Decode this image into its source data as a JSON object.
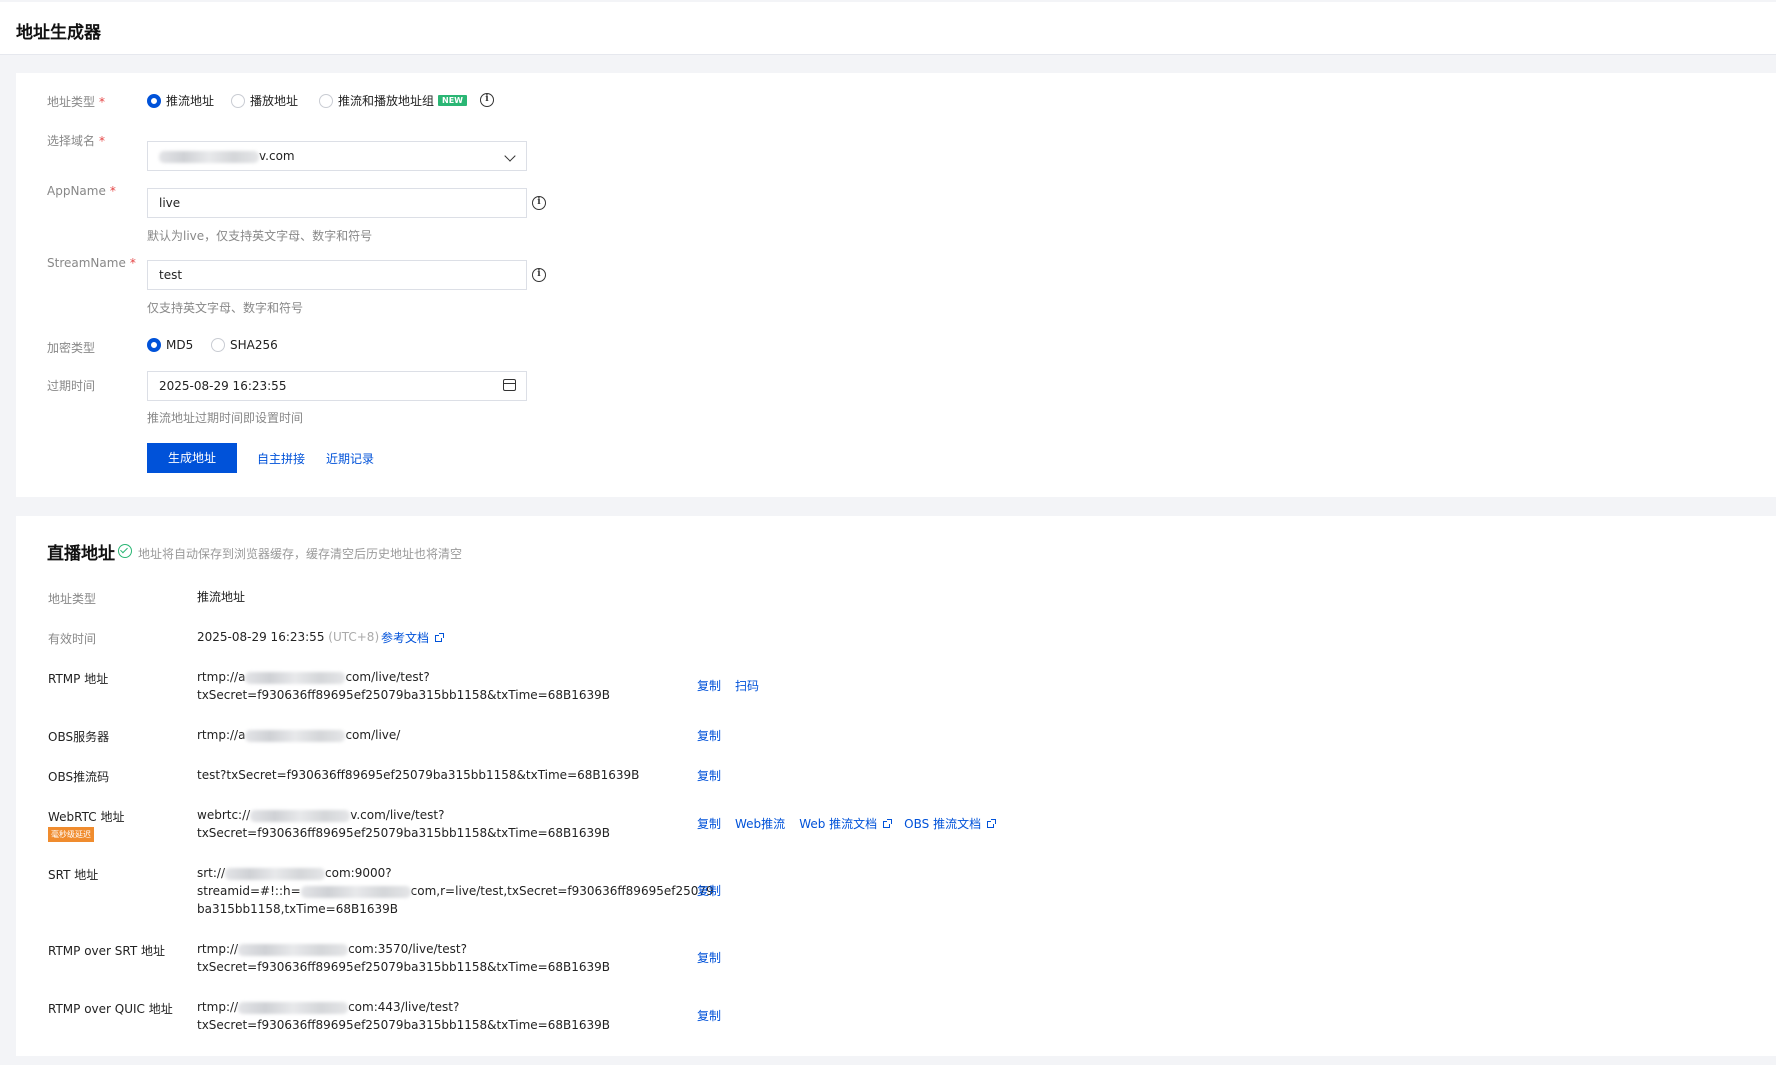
{
  "page": {
    "title": "地址生成器"
  },
  "form": {
    "address_type": {
      "label": "地址类型",
      "options": [
        "推流地址",
        "播放地址",
        "推流和播放地址组"
      ],
      "selected": "推流地址",
      "new_badge": "NEW"
    },
    "domain": {
      "label": "选择域名",
      "value_suffix": "v.com"
    },
    "app_name": {
      "label": "AppName",
      "value": "live",
      "hint": "默认为live，仅支持英文字母、数字和符号"
    },
    "stream_name": {
      "label": "StreamName",
      "value": "test",
      "hint": "仅支持英文字母、数字和符号"
    },
    "encryption": {
      "label": "加密类型",
      "options": [
        "MD5",
        "SHA256"
      ],
      "selected": "MD5"
    },
    "expire": {
      "label": "过期时间",
      "value": "2025-08-29 16:23:55",
      "hint": "推流地址过期时间即设置时间"
    },
    "required_mark": "*",
    "generate_button": "生成地址",
    "custom_link": "自主拼接",
    "recent_link": "近期记录"
  },
  "result": {
    "title": "直播地址",
    "note": "地址将自动保存到浏览器缓存，缓存清空后历史地址也将清空",
    "type_label": "地址类型",
    "type_value": "推流地址",
    "valid_label": "有效时间",
    "valid_value": "2025-08-29 16:23:55",
    "valid_tz": "(UTC+8)",
    "doc_link": "参考文档",
    "rtmp": {
      "label": "RTMP 地址",
      "line1_pre": "rtmp://a",
      "line1_post": "com/live/test?",
      "line2": "txSecret=f930636ff89695ef25079ba315bb1158&txTime=68B1639B",
      "copy": "复制",
      "scan": "扫码"
    },
    "obs_server": {
      "label": "OBS服务器",
      "pre": "rtmp://a",
      "post": "com/live/",
      "copy": "复制"
    },
    "obs_key": {
      "label": "OBS推流码",
      "value": "test?txSecret=f930636ff89695ef25079ba315bb1158&txTime=68B1639B",
      "copy": "复制"
    },
    "webrtc": {
      "label": "WebRTC 地址",
      "tag": "毫秒级延迟",
      "line1_pre": "webrtc://",
      "line1_post": "v.com/live/test?",
      "line2": "txSecret=f930636ff89695ef25079ba315bb1158&txTime=68B1639B",
      "copy": "复制",
      "web_push": "Web推流",
      "web_doc": "Web 推流文档",
      "obs_doc": "OBS 推流文档"
    },
    "srt": {
      "label": "SRT 地址",
      "line1_pre": "srt://",
      "line1_post": "com:9000?",
      "line2_pre": "streamid=#!::h=",
      "line2_post": "com,r=live/test,txSecret=f930636ff89695ef25079",
      "line3": "ba315bb1158,txTime=68B1639B",
      "copy": "复制"
    },
    "rtmp_srt": {
      "label": "RTMP over SRT 地址",
      "line1_pre": "rtmp://",
      "line1_post": "com:3570/live/test?",
      "line2": "txSecret=f930636ff89695ef25079ba315bb1158&txTime=68B1639B",
      "copy": "复制"
    },
    "rtmp_quic": {
      "label": "RTMP over QUIC 地址",
      "line1_pre": "rtmp://",
      "line1_post": "com:443/live/test?",
      "line2": "txSecret=f930636ff89695ef25079ba315bb1158&txTime=68B1639B",
      "copy": "复制"
    }
  },
  "colors": {
    "primary": "#0052d9",
    "success": "#2ab674",
    "warning": "#f08c2e",
    "required": "#e54545"
  }
}
